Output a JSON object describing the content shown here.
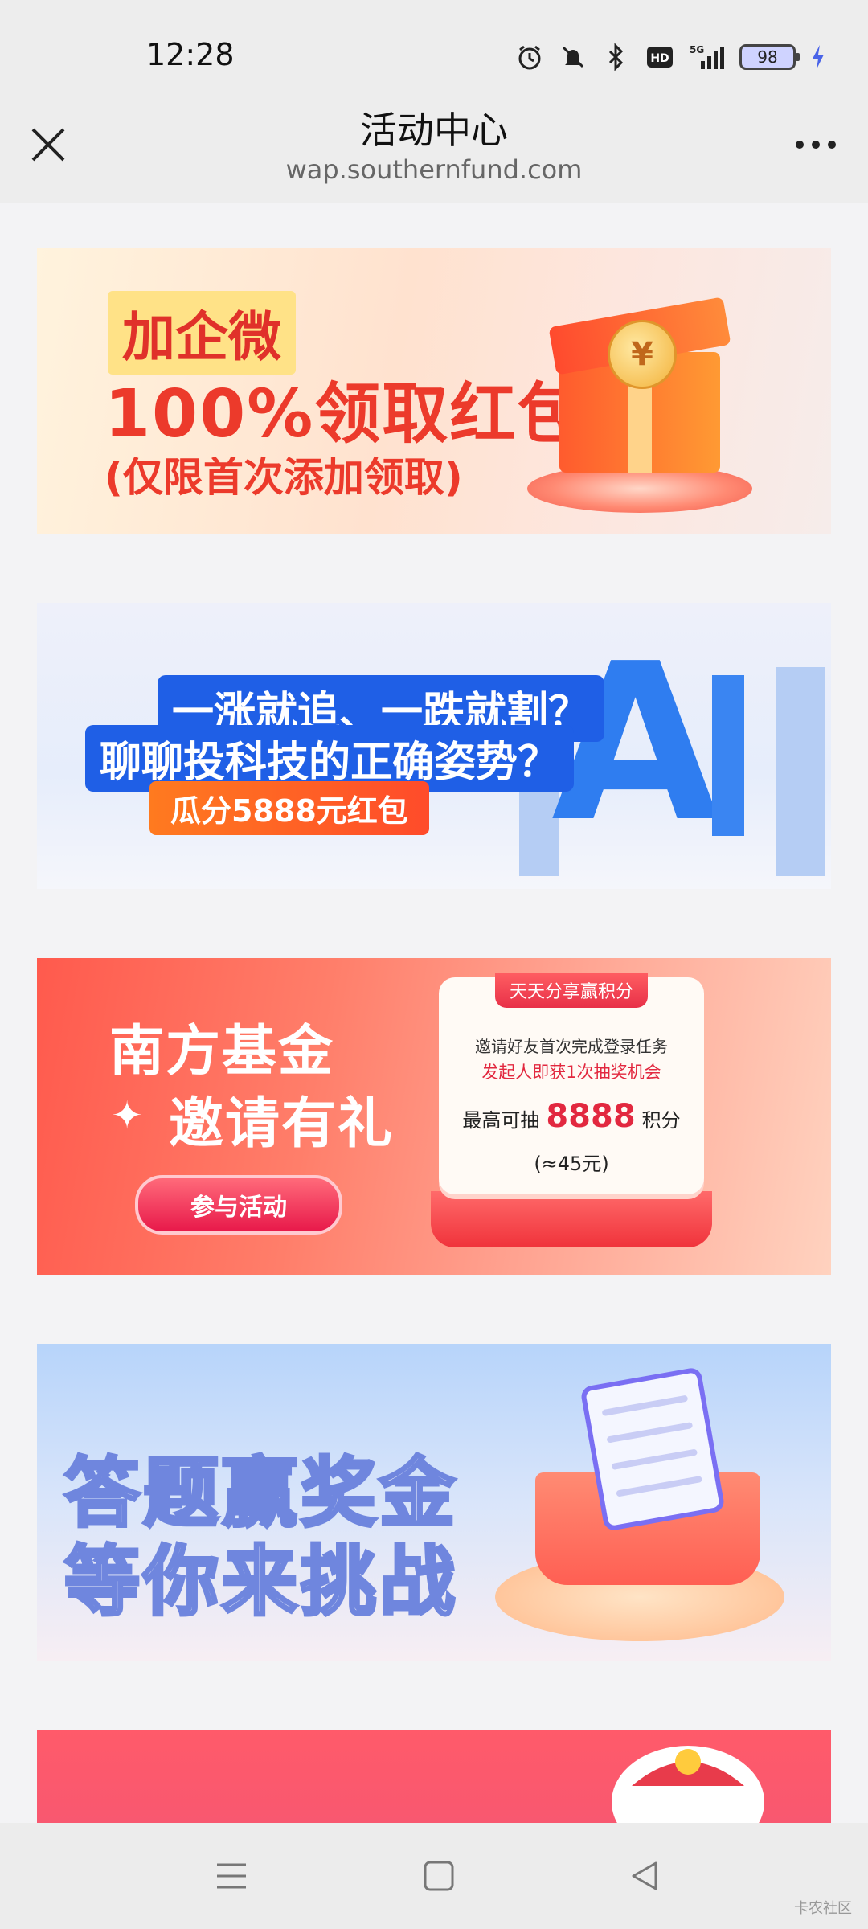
{
  "status_bar": {
    "time": "12:28",
    "icons": [
      "alarm-icon",
      "mute-icon",
      "bluetooth-icon",
      "hd-icon",
      "signal-5g-icon"
    ],
    "hd_label": "HD",
    "network_label": "5G",
    "battery": "98"
  },
  "header": {
    "title": "活动中心",
    "url": "wap.southernfund.com"
  },
  "banners": {
    "b1": {
      "tag": "加企微",
      "headline": "100%领取红包",
      "sub": "(仅限首次添加领取)",
      "coin_symbol": "¥"
    },
    "b2": {
      "line1": "一涨就追、一跌就割？",
      "line2": "聊聊投科技的正确姿势？",
      "badge": "瓜分5888元红包",
      "art_letters": "A"
    },
    "b3": {
      "title1": "南方基金",
      "title2": "邀请有礼",
      "button": "参与活动",
      "card_tab": "天天分享赢积分",
      "card_line1": "邀请好友首次完成登录任务",
      "card_line2": "发起人即获1次抽奖机会",
      "card_prefix": "最高可抽",
      "card_points": "8888",
      "card_suffix": "积分",
      "card_equiv": "(≈45元)"
    },
    "b4": {
      "line1": "答题赢奖金",
      "line2": "等你来挑战"
    }
  },
  "watermark": "卡农社区",
  "colors": {
    "accent_red": "#ec3a2b",
    "accent_blue": "#1f5fe6",
    "nav_bg": "#ececec"
  }
}
